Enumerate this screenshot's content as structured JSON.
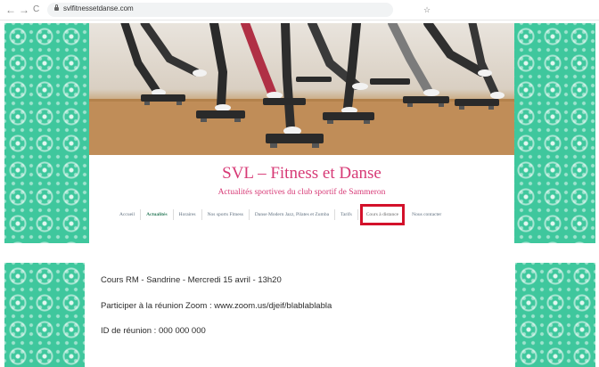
{
  "browser": {
    "back": "←",
    "forward": "→",
    "reload": "C",
    "url": "svlfitnessetdanse.com",
    "bookmark": "☆"
  },
  "site": {
    "title": "SVL – Fitness et Danse",
    "tagline": "Actualités sportives du club sportif de Sammeron"
  },
  "menu": {
    "items": [
      {
        "label": "Accueil"
      },
      {
        "label": "Actualités"
      },
      {
        "label": "Horaires"
      },
      {
        "label": "Nos sports Fitness"
      },
      {
        "label": "Danse Modern Jazz, Pilates et Zumba"
      },
      {
        "label": "Tarifs"
      },
      {
        "label": "Cours à distance"
      },
      {
        "label": "Nous contacter"
      }
    ]
  },
  "content": {
    "line1": "Cours RM - Sandrine - Mercredi 15 avril - 13h20",
    "line2": "Participer à la réunion Zoom : www.zoom.us/djeif/blablablabla",
    "line3": "ID de réunion : 000 000 000"
  },
  "colors": {
    "accent": "#d73a76",
    "pattern": "#3fc79d",
    "highlight": "#d3112a"
  }
}
